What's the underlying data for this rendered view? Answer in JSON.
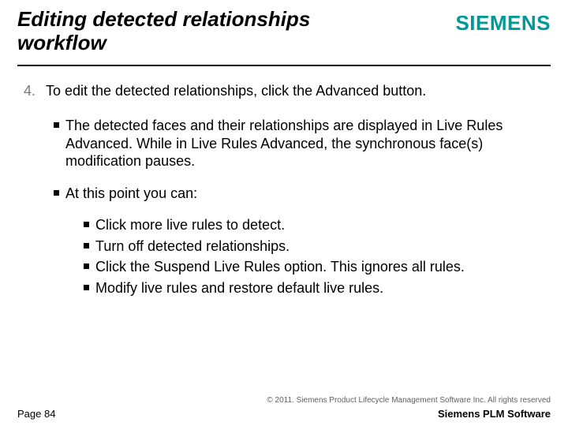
{
  "header": {
    "title": "Editing detected relationships workflow",
    "brand": "SIEMENS"
  },
  "step": {
    "num": "4.",
    "text": "To edit the detected relationships, click the Advanced button."
  },
  "bullets": {
    "b1": "The detected faces and their relationships are displayed in Live Rules Advanced. While in Live Rules Advanced, the synchronous face(s) modification pauses.",
    "b2": "At this point you can:",
    "sub": {
      "s1": "Click more live rules to detect.",
      "s2": "Turn off detected relationships.",
      "s3": "Click the Suspend Live Rules option. This ignores all rules.",
      "s4": "Modify live rules and restore default live rules."
    }
  },
  "footer": {
    "copyright": "© 2011. Siemens Product Lifecycle Management Software Inc. All rights reserved",
    "page": "Page 84",
    "plm": "Siemens PLM Software"
  }
}
